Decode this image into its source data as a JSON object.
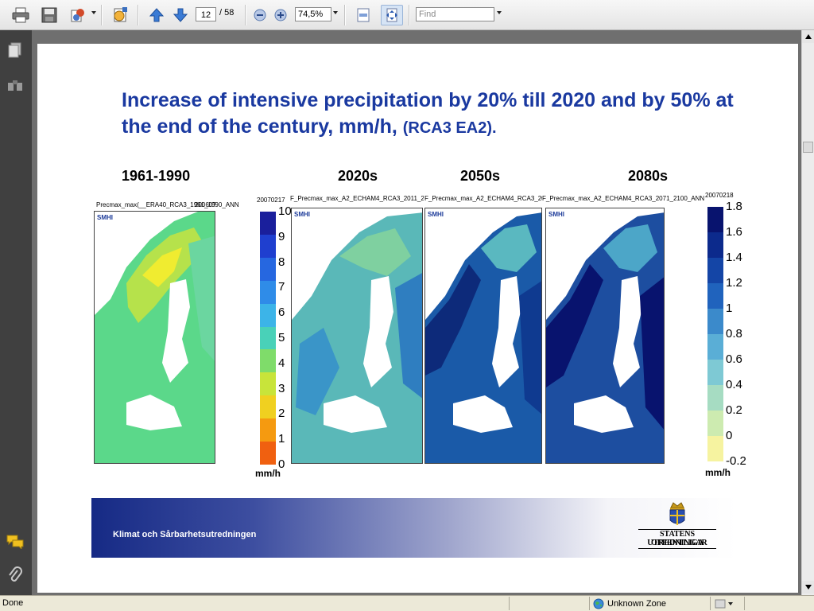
{
  "toolbar": {
    "page_current": "12",
    "page_total": "/ 58",
    "zoom": "74,5%",
    "find_placeholder": "Find"
  },
  "slide": {
    "title": "Increase of intensive precipitation by 20% till 2020 and by 50% at the end of the century, mm/h,",
    "title_suffix": "(RCA3 EA2).",
    "periods": [
      "1961-1990",
      "2020s",
      "2050s",
      "2080s"
    ],
    "map_captions": [
      "Precmax_max(__ERA40_RCA3_1961_1990_ANN",
      "20060?",
      "F_Precmax_max_A2_ECHAM4_RCA3_2011_2040_A",
      "F_Precmax_max_A2_ECHAM4_RCA3_2041_20",
      "F_Precmax_max_A2_ECHAM4_RCA3_2071_2100_ANN"
    ],
    "smhi_label": "SMHI",
    "legend_abs": {
      "date": "20070217",
      "ticks": [
        "10",
        "9",
        "8",
        "7",
        "6",
        "5",
        "4",
        "3",
        "2",
        "1",
        "0"
      ],
      "units": "mm/h",
      "colors": [
        "#1a1f9c",
        "#1f3fcf",
        "#2667e0",
        "#2f8ce8",
        "#3cb4e8",
        "#49d1b8",
        "#7fdc6a",
        "#c8e43a",
        "#f0d020",
        "#f59a10",
        "#f06010"
      ]
    },
    "legend_change": {
      "date": "20070218",
      "ticks": [
        "1.8",
        "1.6",
        "1.4",
        "1.2",
        "1",
        "0.8",
        "0.6",
        "0.4",
        "0.2",
        "0",
        "-0.2"
      ],
      "units": "mm/h",
      "colors": [
        "#08136e",
        "#0c2a8c",
        "#1445a6",
        "#2063bd",
        "#3b8acb",
        "#5aaed6",
        "#7ec9d4",
        "#a6dcc2",
        "#cdebb0",
        "#f6f3a0"
      ]
    },
    "footer_text": "Klimat och Sårbarhetsutredningen",
    "logo_text_1": "STATENS OFFENTLIGA",
    "logo_text_2": "UTREDNINGAR"
  },
  "status": {
    "left": "Done",
    "zone": "Unknown Zone"
  }
}
